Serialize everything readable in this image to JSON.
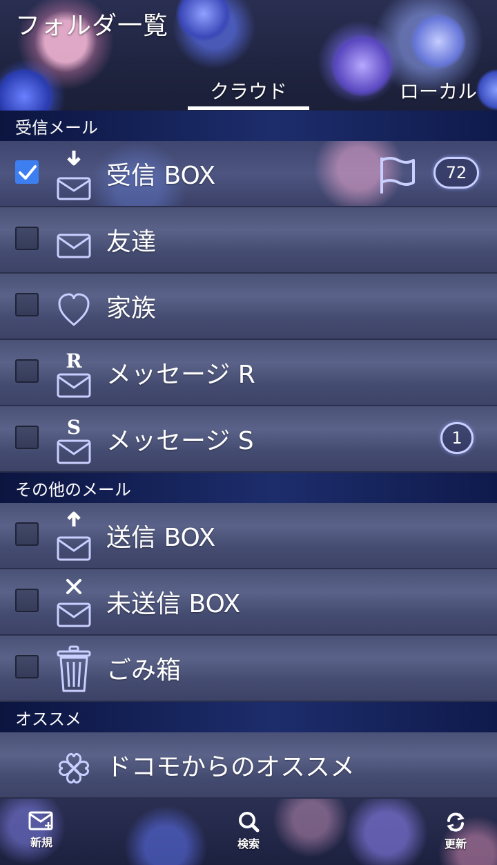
{
  "header": {
    "title": "フォルダ一覧",
    "tabs": [
      {
        "label": "クラウド",
        "active": true
      },
      {
        "label": "ローカル",
        "active": false
      }
    ]
  },
  "sections": [
    {
      "title": "受信メール"
    },
    {
      "title": "その他のメール"
    },
    {
      "title": "オススメ"
    }
  ],
  "folders": [
    {
      "label": "受信 BOX",
      "icon": "inbox-icon",
      "checked": true,
      "flagged": true,
      "badge": "72"
    },
    {
      "label": "友達",
      "icon": "envelope-icon",
      "checked": false,
      "badge": ""
    },
    {
      "label": "家族",
      "icon": "heart-icon",
      "checked": false,
      "badge": ""
    },
    {
      "label": "メッセージ R",
      "icon": "message-r-icon",
      "checked": false,
      "badge": ""
    },
    {
      "label": "メッセージ S",
      "icon": "message-s-icon",
      "checked": false,
      "badge": "1"
    },
    {
      "label": "送信 BOX",
      "icon": "outbox-icon",
      "checked": false,
      "badge": ""
    },
    {
      "label": "未送信 BOX",
      "icon": "unsent-box-icon",
      "checked": false,
      "badge": ""
    },
    {
      "label": "ごみ箱",
      "icon": "trash-icon",
      "checked": false,
      "badge": ""
    },
    {
      "label": "ドコモからのオススメ",
      "icon": "clover-icon",
      "badge": ""
    }
  ],
  "bottom_bar": {
    "new": "新規",
    "search": "検索",
    "refresh": "更新"
  },
  "colors": {
    "checkbox_checked": "#3d7ff0",
    "badge_border": "#c9d0ff",
    "icon_stroke": "#c9d0ff",
    "section_bg": "#1d2d6c"
  }
}
